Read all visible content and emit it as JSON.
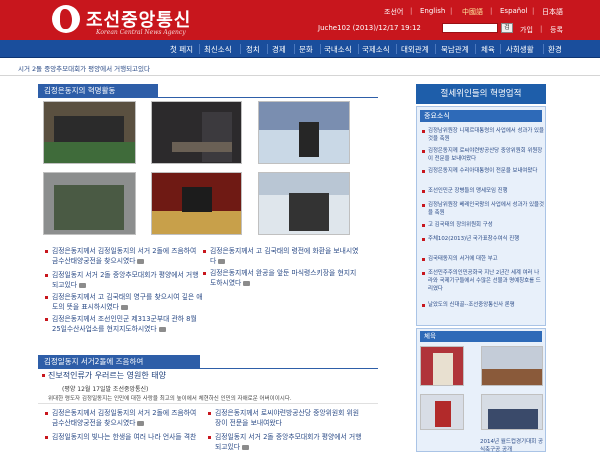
{
  "header": {
    "logo_title": "조선중앙통신",
    "logo_subtitle": "Korean Central News Agency",
    "languages": [
      {
        "label": "조선어",
        "active": false
      },
      {
        "label": "English",
        "active": false
      },
      {
        "label": "中國語",
        "active": true
      },
      {
        "label": "Español",
        "active": false
      },
      {
        "label": "日本語",
        "active": false
      }
    ],
    "datetime": "Juche102 (2013)/12/17 19:12",
    "search_button": "검",
    "join_label": "가입",
    "login_label": "등록"
  },
  "nav": {
    "items": [
      "첫 페지",
      "최신소식",
      "정치",
      "경제",
      "문화",
      "국내소식",
      "국제소식",
      "대외관계",
      "북남관계",
      "체육",
      "사회생활",
      "환경"
    ]
  },
  "ticker": {
    "text": "시거 2돌 중앙추모대회가 평양에서 거행되고있다"
  },
  "activities": {
    "title": "김정은동지의 혁명활동",
    "photos": [
      {
        "name": "photo-leader-with-officials-1",
        "caption": ""
      },
      {
        "name": "photo-leader-night-construction",
        "caption": ""
      },
      {
        "name": "photo-leader-snow-site",
        "caption": ""
      },
      {
        "name": "photo-leader-military-group",
        "caption": ""
      },
      {
        "name": "photo-leader-conference-stage",
        "caption": ""
      },
      {
        "name": "photo-leader-ski-slope",
        "caption": ""
      }
    ],
    "articles_left": [
      {
        "text": "김정은동지께서 김정일동지의 서거 2돌에 즈음하여 금수산태양궁전을 찾으시였다",
        "photo": true
      },
      {
        "text": "김정일동지 서거 2돌 중앙추모대회가 평양에서 거행되고있다",
        "photo": true
      },
      {
        "text": "김정은동지께서 고 김국태의 영구를 찾으시여 깊은 애도의 뜻을 표시하시였다",
        "photo": true
      },
      {
        "text": "김정은동지께서 조선인민군 제313군부대 관하 8월25일수산사업소를 현지지도하시였다",
        "photo": true
      }
    ],
    "articles_right": [
      {
        "text": "김정은동지께서 고 김국태의 령전에 화환을 보내시였다",
        "photo": true
      },
      {
        "text": "김정은동지께서 완공을 앞둔 마식령스키장을 현지지도하시였다",
        "photo": true
      }
    ]
  },
  "memorial": {
    "title": "김정일동지 서거2돌에 즈음하여",
    "headline": "진보적인류가 우러르는 영원한 태양",
    "headline_source": "(평양 12월 17일발 조선중앙통신)",
    "headline_body": "위대한 령도자 김정일동지는 인민에 대한 사랑을 최고의 높이에서 체현하신 인민의 자애로운 어버이이시다.",
    "articles_left": [
      {
        "text": "김정은동지께서 김정일동지의 서거 2돌에 즈음하여 금수산태양궁전을 찾으시였다",
        "photo": true
      },
      {
        "text": "김정일동지의 빛나는 한생을 여러 나라 언사들 격찬",
        "photo": false
      }
    ],
    "articles_right": [
      {
        "text": "김정은동지께서 로씨야련방공산당 중앙위원회 위원장이 전문을 보내여왔다",
        "photo": false
      },
      {
        "text": "김정일동지 서거 2돌 중앙추모대회가 평양에서 거행되고있다",
        "photo": true
      }
    ]
  },
  "sidebar": {
    "banner": "절세위인들의 혁명업적",
    "news_title": "중요소식",
    "news": [
      "김정남위원장 니제르대통령의 사업에서 성과가 있을것을 축원",
      "김정은동지께 로씨야련방공산당 중앙위원회 위원장이 전문을 보내여왔다",
      "김정은동지께 수리아대통령이 전문을 보내여왔다",
      "조선인민군 장병들의 맹세모임 진행",
      "김정남위원장 베레인국왕의 사업에서 성과가 있을것을 축원",
      "고 김국태의 장의위원회 구성",
      "주체102(2013)년 국가표창수여식 진행",
      "김국태동지의 서거에 대한 부고",
      "조선민주주의인민공화국 지난 2년간 세계 여러 나라와 국제기구들에서 수많은 선물과 명예칭호를 드리였다",
      "날았도의 신대골--조선중앙통신사 론평"
    ],
    "sports_title": "체육",
    "sports_caption": "2014년 월드컵경기대회 공식축구공 공개"
  },
  "colors": {
    "brand_red": "#c8161d",
    "nav_blue": "#1a4e9c",
    "section_blue": "#2e5ea8",
    "link_blue": "#2a4a86"
  }
}
